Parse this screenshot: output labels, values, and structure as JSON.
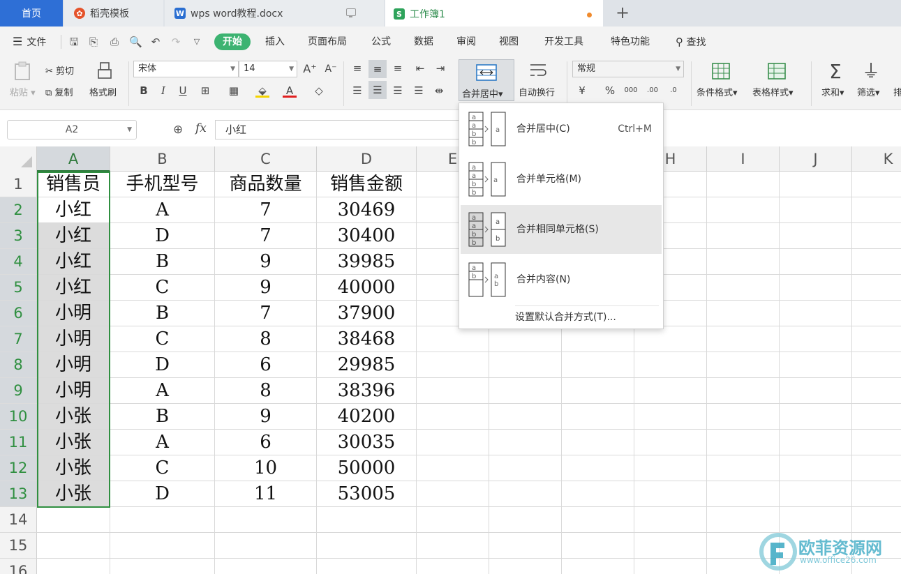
{
  "tabs": {
    "home": "首页",
    "daoke": "稻壳模板",
    "word": "wps word教程.docx",
    "book": "工作簿1",
    "new_tab": "+"
  },
  "menu": {
    "file": "文件",
    "items": [
      "开始",
      "插入",
      "页面布局",
      "公式",
      "数据",
      "审阅",
      "视图",
      "开发工具",
      "特色功能"
    ],
    "search": "查找"
  },
  "ribbon": {
    "paste": "粘贴",
    "cut": "剪切",
    "copy": "复制",
    "format_painter": "格式刷",
    "font_name": "宋体",
    "font_size": "14",
    "merge_center": "合并居中",
    "wrap_text": "自动换行",
    "number_format": "常规",
    "conditional_format": "条件格式",
    "table_style": "表格样式",
    "sum": "求和",
    "filter": "筛选",
    "sort": "排"
  },
  "formula_bar": {
    "name_box": "A2",
    "fx": "fx",
    "content": "小红"
  },
  "sheet": {
    "columns": [
      "A",
      "B",
      "C",
      "D",
      "E",
      "F",
      "G",
      "H",
      "I",
      "J",
      "K"
    ],
    "row_numbers": [
      "1",
      "2",
      "3",
      "4",
      "5",
      "6",
      "7",
      "8",
      "9",
      "10",
      "11",
      "12",
      "13",
      "14",
      "15",
      "16"
    ],
    "rows": [
      [
        "销售员",
        "手机型号",
        "商品数量",
        "销售金额"
      ],
      [
        "小红",
        "A",
        "7",
        "30469"
      ],
      [
        "小红",
        "D",
        "7",
        "30400"
      ],
      [
        "小红",
        "B",
        "9",
        "39985"
      ],
      [
        "小红",
        "C",
        "9",
        "40000"
      ],
      [
        "小明",
        "B",
        "7",
        "37900"
      ],
      [
        "小明",
        "C",
        "8",
        "38468"
      ],
      [
        "小明",
        "D",
        "6",
        "29985"
      ],
      [
        "小明",
        "A",
        "8",
        "38396"
      ],
      [
        "小张",
        "B",
        "9",
        "40200"
      ],
      [
        "小张",
        "A",
        "6",
        "30035"
      ],
      [
        "小张",
        "C",
        "10",
        "50000"
      ],
      [
        "小张",
        "D",
        "11",
        "53005"
      ]
    ]
  },
  "merge_menu": {
    "items": [
      {
        "label": "合并居中(C)",
        "shortcut": "Ctrl+M"
      },
      {
        "label": "合并单元格(M)",
        "shortcut": ""
      },
      {
        "label": "合并相同单元格(S)",
        "shortcut": ""
      },
      {
        "label": "合并内容(N)",
        "shortcut": ""
      }
    ],
    "default_option": "设置默认合并方式(T)..."
  },
  "watermark": {
    "title": "欧菲资源网",
    "url": "www.office26.com"
  },
  "colors": {
    "accent_green": "#2f8f40",
    "start_button": "#3cb371",
    "home_tab": "#2e6fd6",
    "watermark": "#4ab0c8"
  }
}
